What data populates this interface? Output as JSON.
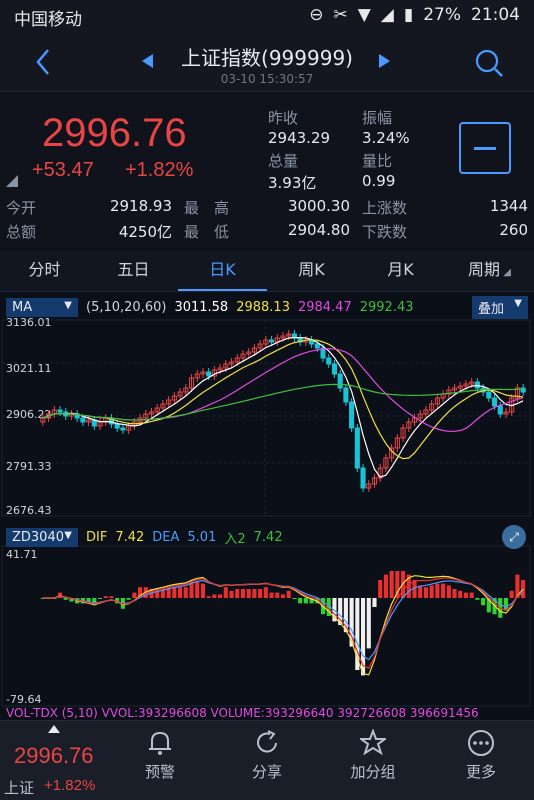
{
  "status": {
    "carrier": "中国移动",
    "battery": "27%",
    "time": "21:04"
  },
  "header": {
    "title": "上证指数(999999)",
    "datetime": "03-10 15:30:57"
  },
  "quote": {
    "price": "2996.76",
    "change": "+53.47",
    "change_pct": "+1.82%",
    "prev_close_label": "昨收",
    "prev_close": "2943.29",
    "amplitude_label": "振幅",
    "amplitude": "3.24%",
    "volume_label": "总量",
    "volume": "3.93亿",
    "vol_ratio_label": "量比",
    "vol_ratio": "0.99",
    "open_label": "今开",
    "open": "2918.93",
    "high_label": "最　高",
    "high": "3000.30",
    "up_label": "上涨数",
    "up": "1344",
    "amount_label": "总额",
    "amount": "4250亿",
    "low_label": "最　低",
    "low": "2904.80",
    "down_label": "下跌数",
    "down": "260"
  },
  "tabs": [
    "分时",
    "五日",
    "日K",
    "周K",
    "月K",
    "周期"
  ],
  "ma_bar": {
    "name": "MA",
    "params": "(5,10,20,60)",
    "ma5": "3011.58",
    "ma10": "2988.13",
    "ma20": "2984.47",
    "ma60": "2992.43",
    "overlay": "叠加"
  },
  "y_ticks": [
    "3136.01",
    "3021.11",
    "2906.22",
    "2791.33",
    "2676.43"
  ],
  "ind_bar": {
    "name": "ZD3040",
    "dif_label": "DIF",
    "dif": "7.42",
    "dea_label": "DEA",
    "dea": "5.01",
    "in2_label": "入2",
    "in2": "7.42"
  },
  "ind_ticks": [
    "41.71",
    "-79.64"
  ],
  "vol_bar": "VOL-TDX (5,10) VVOL:393296608 VOLUME:393296640 392726608 396691456",
  "footer": {
    "mini_price": "2996.76",
    "mini_name": "上证",
    "mini_pct": "+1.82%",
    "alert": "预警",
    "share": "分享",
    "watch": "加分组",
    "more": "更多"
  },
  "colors": {
    "up": "#e84545",
    "down": "#19c3d6",
    "ma5": "#ffffff",
    "ma10": "#f0e040",
    "ma20": "#e24ae0",
    "ma60": "#3fbf3f",
    "accent": "#4a9bff"
  },
  "chart_data": {
    "type": "candlestick",
    "y_range": [
      2676.43,
      3136.01
    ],
    "indicator_range": [
      -79.64,
      41.71
    ],
    "note_series": [
      "MA5",
      "MA10",
      "MA20",
      "MA60"
    ]
  }
}
